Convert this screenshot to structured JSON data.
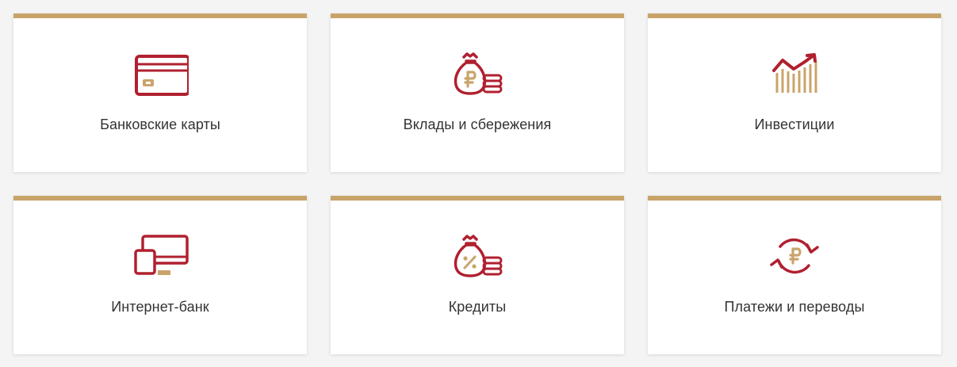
{
  "colors": {
    "accent_gold": "#c9a46a",
    "accent_red": "#b0202f",
    "text": "#333333"
  },
  "cards": [
    {
      "label": "Банковские карты",
      "icon": "credit-card-icon"
    },
    {
      "label": "Вклады и сбережения",
      "icon": "money-bag-ruble-icon"
    },
    {
      "label": "Инвестиции",
      "icon": "growth-chart-icon"
    },
    {
      "label": "Интернет-банк",
      "icon": "devices-icon"
    },
    {
      "label": "Кредиты",
      "icon": "money-bag-percent-icon"
    },
    {
      "label": "Платежи и переводы",
      "icon": "ruble-exchange-icon"
    }
  ]
}
